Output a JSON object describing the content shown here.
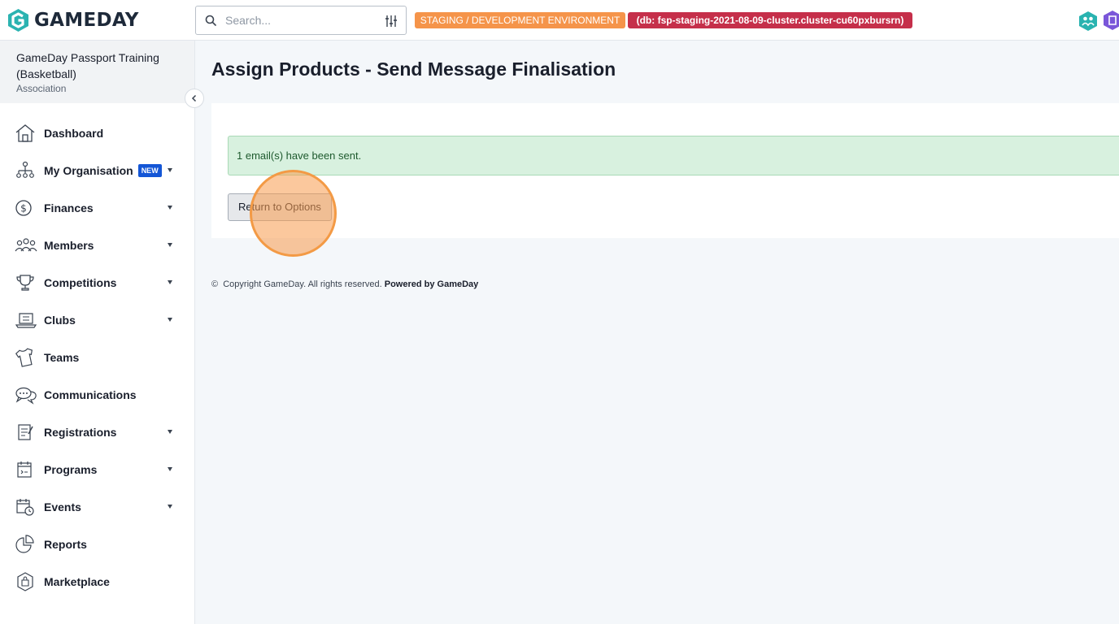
{
  "topbar": {
    "brand": "GAMEDAY",
    "search_placeholder": "Search...",
    "env_badge": "STAGING / DEVELOPMENT ENVIRONMENT",
    "db_badge": "(db: fsp-staging-2021-08-09-cluster.cluster-cu60pxbursrn)",
    "colors": {
      "env": "#f5944a",
      "db": "#c52f4a"
    }
  },
  "sidebar": {
    "org_name": "GameDay Passport Training (Basketball)",
    "org_type": "Association",
    "items": [
      {
        "label": "Dashboard",
        "icon": "home-icon",
        "has_caret": false
      },
      {
        "label": "My Organisation",
        "icon": "org-chart-icon",
        "badge": "NEW",
        "has_caret": true
      },
      {
        "label": "Finances",
        "icon": "dollar-circle-icon",
        "has_caret": true
      },
      {
        "label": "Members",
        "icon": "members-icon",
        "has_caret": true
      },
      {
        "label": "Competitions",
        "icon": "trophy-icon",
        "has_caret": true
      },
      {
        "label": "Clubs",
        "icon": "clubhouse-icon",
        "has_caret": true
      },
      {
        "label": "Teams",
        "icon": "jersey-icon",
        "has_caret": false
      },
      {
        "label": "Communications",
        "icon": "chat-bubbles-icon",
        "has_caret": false
      },
      {
        "label": "Registrations",
        "icon": "clipboard-icon",
        "has_caret": true
      },
      {
        "label": "Programs",
        "icon": "calendar-check-icon",
        "has_caret": true
      },
      {
        "label": "Events",
        "icon": "calendar-clock-icon",
        "has_caret": true
      },
      {
        "label": "Reports",
        "icon": "pie-chart-icon",
        "has_caret": false
      },
      {
        "label": "Marketplace",
        "icon": "shopping-bag-icon",
        "has_caret": false
      }
    ]
  },
  "main": {
    "title": "Assign Products - Send Message Finalisation",
    "alert": "1 email(s) have been sent.",
    "return_button": "Return to Options"
  },
  "footer": {
    "copyright": "Copyright GameDay. All rights reserved.",
    "powered_by": "Powered by GameDay"
  }
}
